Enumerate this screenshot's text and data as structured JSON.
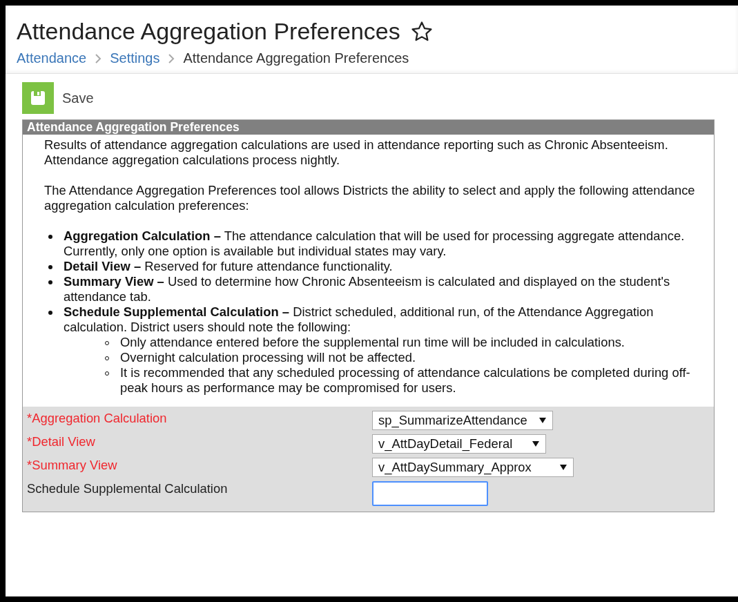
{
  "title": "Attendance Aggregation Preferences",
  "favorite": false,
  "breadcrumbs": [
    {
      "label": "Attendance",
      "link": true
    },
    {
      "label": "Settings",
      "link": true
    },
    {
      "label": "Attendance Aggregation Preferences",
      "link": false
    }
  ],
  "toolbar": {
    "save": "Save"
  },
  "panel": {
    "header": "Attendance Aggregation Preferences",
    "paragraphs": [
      "Results of attendance aggregation calculations are used in attendance reporting such as Chronic Absenteeism. Attendance aggregation calculations process nightly.",
      "The Attendance Aggregation Preferences tool allows Districts the ability to select and apply the following attendance aggregation calculation preferences:"
    ],
    "bullets": [
      {
        "text": "**Aggregation Calculation –** The attendance calculation that will be used for processing aggregate attendance. Currently, only one option is available but individual states may vary."
      },
      {
        "text": "**Detail View –** Reserved for future attendance functionality."
      },
      {
        "text": "**Summary View –** Used to determine how Chronic Absenteeism is calculated and displayed on the student's attendance tab."
      },
      {
        "text": "**Schedule Supplemental Calculation –** District scheduled, additional run, of the Attendance Aggregation calculation. District users should note the following:",
        "children": [
          {
            "text": "Only attendance entered before the supplemental run time will be included in calculations."
          },
          {
            "text": "Overnight calculation processing will not be affected."
          },
          {
            "text": "It is recommended that any scheduled processing of attendance calculations be completed during off-peak hours as performance may be compromised for users."
          }
        ]
      }
    ],
    "fields": [
      {
        "kind": "select",
        "label": "*Aggregation Calculation",
        "required": true,
        "value": "sp_SummarizeAttendance"
      },
      {
        "kind": "select",
        "label": "*Detail View",
        "required": true,
        "value": "v_AttDayDetail_Federal"
      },
      {
        "kind": "select",
        "label": "*Summary View",
        "required": true,
        "value": "v_AttDaySummary_Approx"
      },
      {
        "kind": "text",
        "label": "Schedule Supplemental Calculation",
        "required": false,
        "focused": true
      }
    ]
  }
}
